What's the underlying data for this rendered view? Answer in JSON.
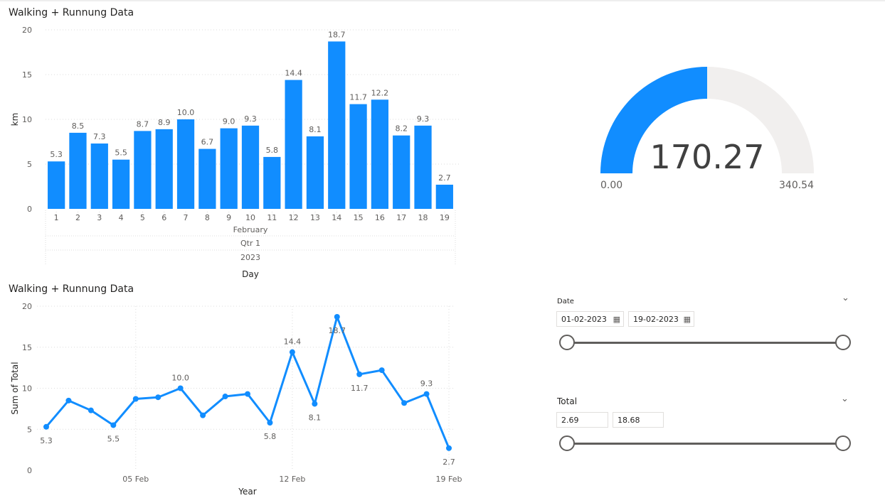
{
  "bar_visual": {
    "title": "Walking + Runnung Data"
  },
  "line_visual": {
    "title": "Walking + Runnung Data"
  },
  "chart_data": [
    {
      "type": "bar",
      "title": "Walking + Runnung Data",
      "ylabel": "km",
      "xlabel": "Day",
      "categories": [
        "1",
        "2",
        "3",
        "4",
        "5",
        "6",
        "7",
        "8",
        "9",
        "10",
        "11",
        "12",
        "13",
        "14",
        "15",
        "16",
        "17",
        "18",
        "19"
      ],
      "values": [
        5.3,
        8.5,
        7.3,
        5.5,
        8.7,
        8.9,
        10.0,
        6.7,
        9.0,
        9.3,
        5.8,
        14.4,
        8.1,
        18.7,
        11.7,
        12.2,
        8.2,
        9.3,
        2.7
      ],
      "data_labels": [
        "5.3",
        "8.5",
        "7.3",
        "5.5",
        "8.7",
        "8.9",
        "10.0",
        "6.7",
        "9.0",
        "9.3",
        "5.8",
        "14.4",
        "8.1",
        "18.7",
        "11.7",
        "12.2",
        "8.2",
        "9.3",
        "2.7"
      ],
      "hierarchy_labels": [
        "February",
        "Qtr 1",
        "2023"
      ],
      "ylim": [
        0,
        20
      ],
      "yticks": [
        "0",
        "5",
        "10",
        "15",
        "20"
      ],
      "color": "#118DFF",
      "grid": true
    },
    {
      "type": "line",
      "title": "Walking + Runnung Data",
      "ylabel": "Sum of Total",
      "xlabel": "Year",
      "x": [
        1,
        2,
        3,
        4,
        5,
        6,
        7,
        8,
        9,
        10,
        11,
        12,
        13,
        14,
        15,
        16,
        17,
        18,
        19
      ],
      "values": [
        5.3,
        8.5,
        7.3,
        5.5,
        8.7,
        8.9,
        10.0,
        6.7,
        9.0,
        9.3,
        5.8,
        14.4,
        8.1,
        18.7,
        11.7,
        12.2,
        8.2,
        9.3,
        2.7
      ],
      "point_labels": [
        {
          "index": 0,
          "text": "5.3",
          "pos": "below"
        },
        {
          "index": 3,
          "text": "5.5",
          "pos": "below"
        },
        {
          "index": 6,
          "text": "10.0",
          "pos": "above"
        },
        {
          "index": 10,
          "text": "5.8",
          "pos": "below"
        },
        {
          "index": 11,
          "text": "14.4",
          "pos": "above"
        },
        {
          "index": 12,
          "text": "8.1",
          "pos": "below"
        },
        {
          "index": 13,
          "text": "18.7",
          "pos": "below"
        },
        {
          "index": 14,
          "text": "11.7",
          "pos": "below"
        },
        {
          "index": 17,
          "text": "9.3",
          "pos": "above"
        },
        {
          "index": 18,
          "text": "2.7",
          "pos": "below"
        }
      ],
      "xticks": [
        {
          "x": 5,
          "label": "05 Feb"
        },
        {
          "x": 12,
          "label": "12 Feb"
        },
        {
          "x": 19,
          "label": "19 Feb"
        }
      ],
      "ylim": [
        0,
        20
      ],
      "yticks": [
        "0",
        "5",
        "10",
        "15",
        "20"
      ],
      "color": "#118DFF",
      "grid": true
    },
    {
      "type": "gauge",
      "value": 170.27,
      "value_label": "170.27",
      "min": 0,
      "max": 340.54,
      "min_label": "0.00",
      "max_label": "340.54",
      "fill_color": "#118DFF",
      "track_color": "#F1EFEE"
    }
  ],
  "date_slicer": {
    "label": "Date",
    "start": "01-02-2023",
    "end": "19-02-2023",
    "chevron": "chevron-down-icon",
    "calendar_icon": "calendar-icon"
  },
  "total_slicer": {
    "label": "Total",
    "min": "2.69",
    "max": "18.68",
    "chevron": "chevron-down-icon"
  }
}
